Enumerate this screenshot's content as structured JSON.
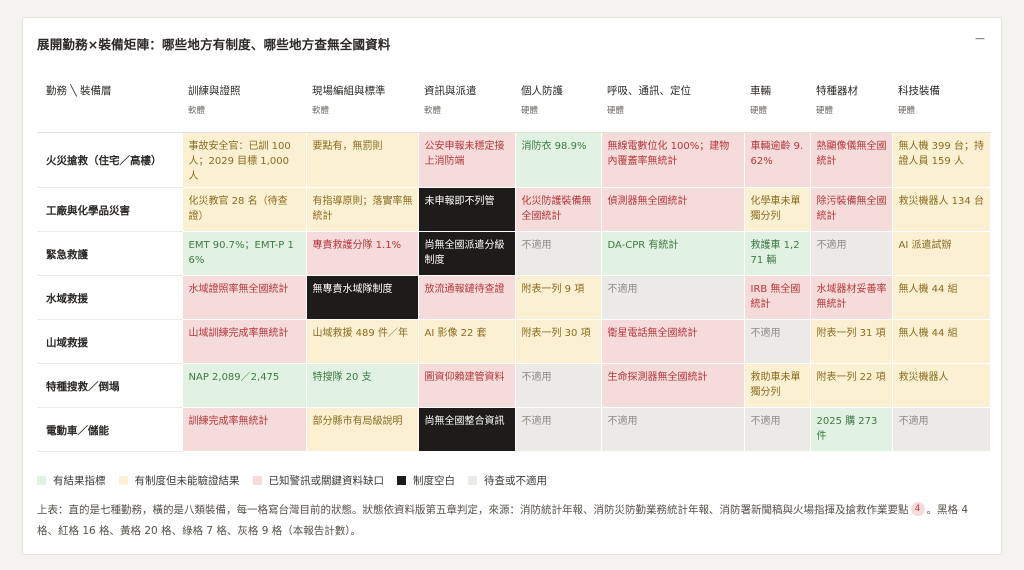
{
  "title": "展開勤務×裝備矩陣：哪些地方有制度、哪些地方查無全國資料",
  "collapse_label": "−",
  "corner_header": "勤務 ╲ 裝備層",
  "columns": [
    {
      "label": "訓練與證照",
      "sub": "軟體"
    },
    {
      "label": "現場編組與標準",
      "sub": "軟體"
    },
    {
      "label": "資訊與派遣",
      "sub": "軟體"
    },
    {
      "label": "個人防護",
      "sub": "硬體"
    },
    {
      "label": "呼吸、通訊、定位",
      "sub": "硬體"
    },
    {
      "label": "車輛",
      "sub": "硬體"
    },
    {
      "label": "特種器材",
      "sub": "硬體"
    },
    {
      "label": "科技裝備",
      "sub": "硬體"
    }
  ],
  "rows": [
    {
      "label": "火災搶救（住宅／高樓）",
      "cells": [
        {
          "text": "事故安全官：已訓 100 人；2029 目標 1,000 人",
          "status": "y"
        },
        {
          "text": "要點有，無罰則",
          "status": "y"
        },
        {
          "text": "公安申報未穩定接上消防端",
          "status": "r"
        },
        {
          "text": "消防衣 98.9%",
          "status": "g"
        },
        {
          "text": "無線電數位化 100%；建物內覆蓋率無統計",
          "status": "r"
        },
        {
          "text": "車輛逾齡 9.62%",
          "status": "r"
        },
        {
          "text": "熱顯像儀無全國統計",
          "status": "r"
        },
        {
          "text": "無人機 399 台；持證人員 159 人",
          "status": "y"
        }
      ]
    },
    {
      "label": "工廠與化學品災害",
      "cells": [
        {
          "text": "化災教官 28 名（待查證）",
          "status": "y"
        },
        {
          "text": "有指導原則；落實率無統計",
          "status": "y"
        },
        {
          "text": "未申報即不列管",
          "status": "k"
        },
        {
          "text": "化災防護裝備無全國統計",
          "status": "r"
        },
        {
          "text": "偵測器無全國統計",
          "status": "r"
        },
        {
          "text": "化學車未單獨分列",
          "status": "y"
        },
        {
          "text": "除污裝備無全國統計",
          "status": "r"
        },
        {
          "text": "救災機器人 134 台",
          "status": "y"
        }
      ]
    },
    {
      "label": "緊急救護",
      "cells": [
        {
          "text": "EMT 90.7%；EMT-P 16%",
          "status": "g"
        },
        {
          "text": "專責救護分隊 1.1%",
          "status": "r"
        },
        {
          "text": "尚無全國派遣分級制度",
          "status": "k"
        },
        {
          "text": "不適用",
          "status": "x"
        },
        {
          "text": "DA-CPR 有統計",
          "status": "g"
        },
        {
          "text": "救護車 1,271 輛",
          "status": "g"
        },
        {
          "text": "不適用",
          "status": "x"
        },
        {
          "text": "AI 派遣試辦",
          "status": "y"
        }
      ]
    },
    {
      "label": "水域救援",
      "cells": [
        {
          "text": "水域證照率無全國統計",
          "status": "r"
        },
        {
          "text": "無專責水域隊制度",
          "status": "k"
        },
        {
          "text": "放流通報鏈待查證",
          "status": "r"
        },
        {
          "text": "附表一列 9 項",
          "status": "y"
        },
        {
          "text": "不適用",
          "status": "x"
        },
        {
          "text": "IRB 無全國統計",
          "status": "r"
        },
        {
          "text": "水域器材妥善率無統計",
          "status": "r"
        },
        {
          "text": "無人機 44 組",
          "status": "y"
        }
      ]
    },
    {
      "label": "山域救援",
      "cells": [
        {
          "text": "山域訓練完成率無統計",
          "status": "r"
        },
        {
          "text": "山域救援 489 件／年",
          "status": "y"
        },
        {
          "text": "AI 影像 22 套",
          "status": "y"
        },
        {
          "text": "附表一列 30 項",
          "status": "y"
        },
        {
          "text": "衛星電話無全國統計",
          "status": "r"
        },
        {
          "text": "不適用",
          "status": "x"
        },
        {
          "text": "附表一列 31 項",
          "status": "y"
        },
        {
          "text": "無人機 44 組",
          "status": "y"
        }
      ]
    },
    {
      "label": "特種搜救／倒塌",
      "cells": [
        {
          "text": "NAP 2,089／2,475",
          "status": "g"
        },
        {
          "text": "特搜隊 20 支",
          "status": "g"
        },
        {
          "text": "圖資仰賴建管資料",
          "status": "r"
        },
        {
          "text": "不適用",
          "status": "x"
        },
        {
          "text": "生命探測器無全國統計",
          "status": "r"
        },
        {
          "text": "救助車未單獨分列",
          "status": "y"
        },
        {
          "text": "附表一列 22 項",
          "status": "y"
        },
        {
          "text": "救災機器人",
          "status": "y"
        }
      ]
    },
    {
      "label": "電動車／儲能",
      "cells": [
        {
          "text": "訓練完成率無統計",
          "status": "r"
        },
        {
          "text": "部分縣市有局級說明",
          "status": "y"
        },
        {
          "text": "尚無全國整合資訊",
          "status": "k"
        },
        {
          "text": "不適用",
          "status": "x"
        },
        {
          "text": "不適用",
          "status": "x"
        },
        {
          "text": "不適用",
          "status": "x"
        },
        {
          "text": "2025 購 273 件",
          "status": "g"
        },
        {
          "text": "不適用",
          "status": "x"
        }
      ]
    }
  ],
  "legend": [
    {
      "label": "有結果指標",
      "status": "g"
    },
    {
      "label": "有制度但未能驗證結果",
      "status": "y"
    },
    {
      "label": "已知警訊或關鍵資料缺口",
      "status": "r"
    },
    {
      "label": "制度空白",
      "status": "k"
    },
    {
      "label": "待查或不適用",
      "status": "x"
    }
  ],
  "colors": {
    "g": "#e2f2e2",
    "y": "#fbf1d2",
    "r": "#f6dbdb",
    "k": "#1d1c1a",
    "x": "#eceae6"
  },
  "footnote": {
    "text_before": "上表：直的是七種勤務，橫的是八類裝備，每一格寫台灣目前的狀態。狀態依資料版第五章判定，來源：消防統計年報、消防災防勤業務統計年報、消防署新聞稿與火場指揮及搶救作業要點",
    "ref": "4",
    "text_after": "。黑格 4 格、紅格 16 格、黃格 20 格、綠格 7 格、灰格 9 格（本報告計數）。"
  }
}
